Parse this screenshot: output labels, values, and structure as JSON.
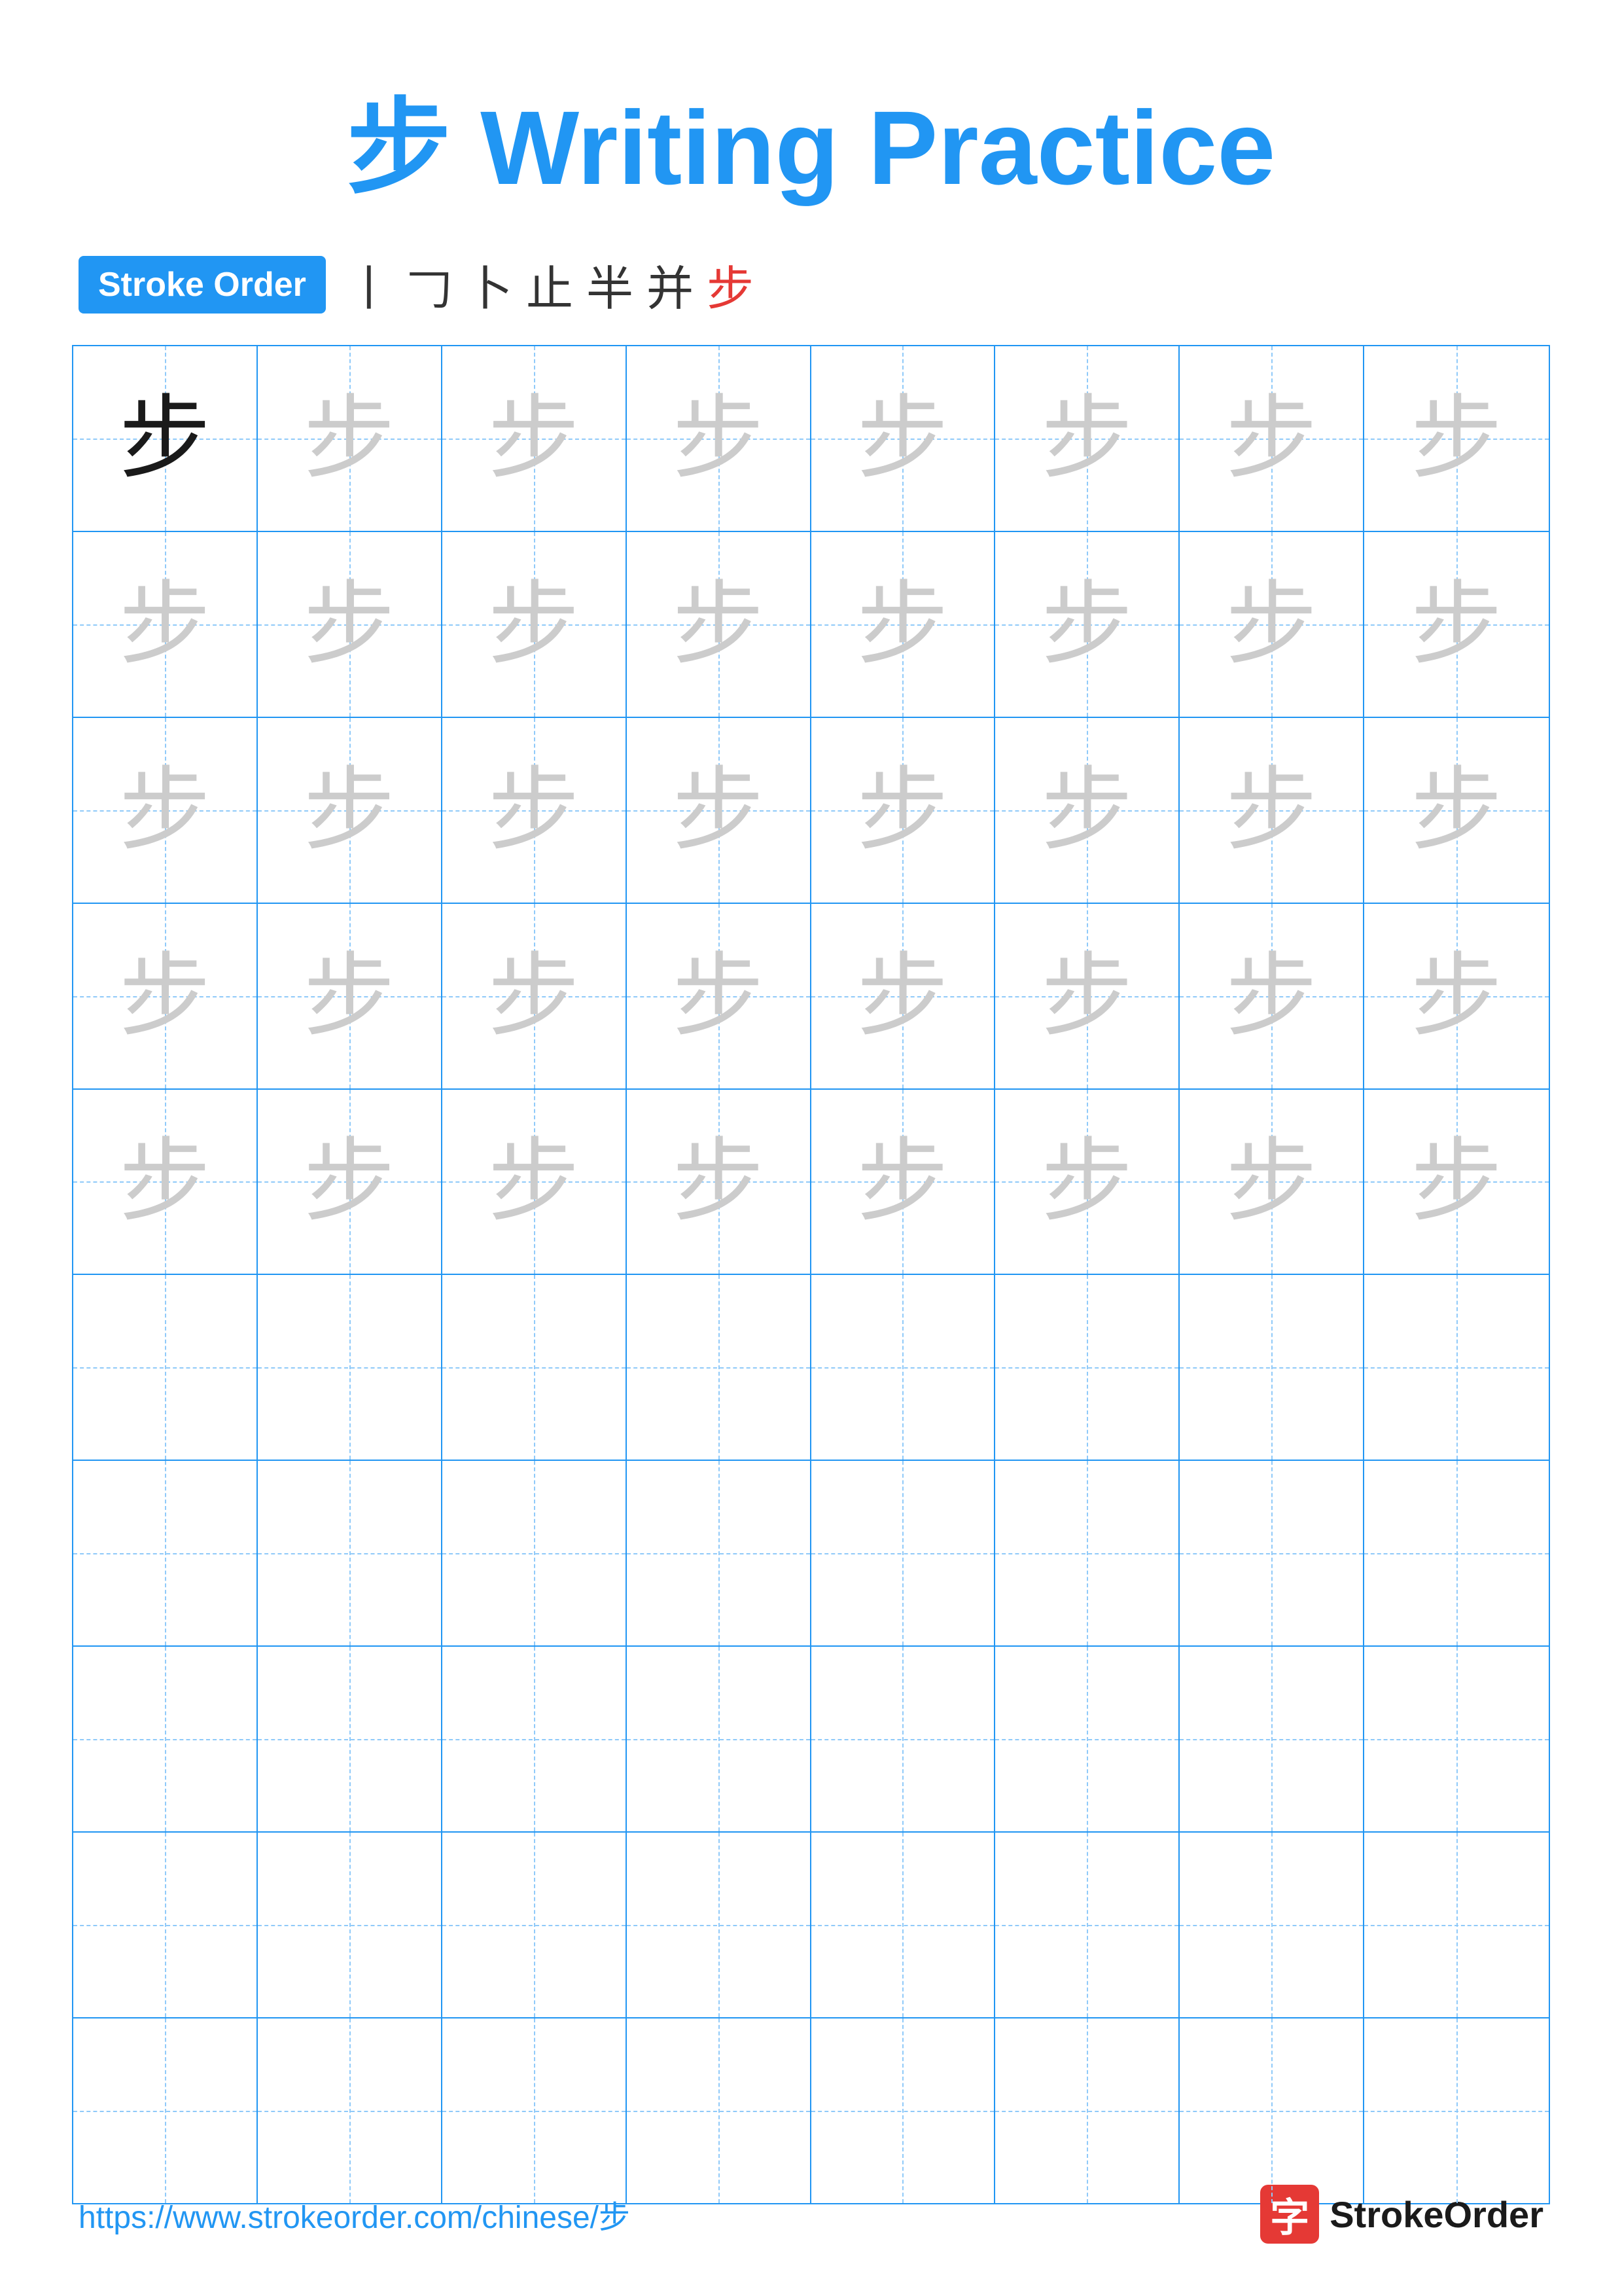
{
  "title": {
    "character": "步",
    "label": "Writing Practice",
    "full": "步 Writing Practice"
  },
  "stroke_order": {
    "badge_label": "Stroke Order",
    "strokes": [
      "丨",
      "𠃌",
      "卜",
      "止",
      "半",
      "并",
      "步"
    ]
  },
  "grid": {
    "rows": 10,
    "cols": 8,
    "character": "步",
    "practice_rows": 5,
    "empty_rows": 5
  },
  "footer": {
    "url": "https://www.strokeorder.com/chinese/步",
    "logo_char": "字",
    "logo_text": "StrokeOrder"
  },
  "colors": {
    "blue": "#2196F3",
    "red": "#e53935",
    "solid_char": "#1a1a1a",
    "faded_char": "#cccccc",
    "guide_line": "#90CAF9"
  }
}
